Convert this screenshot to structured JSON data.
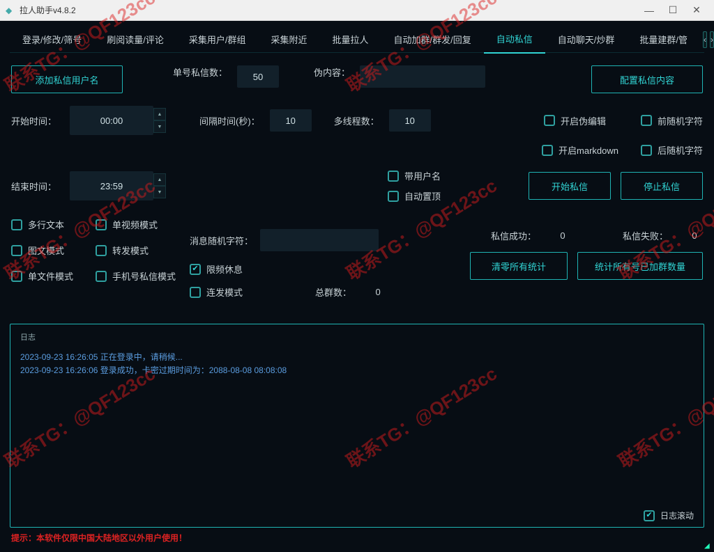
{
  "titlebar": {
    "title": "拉人助手v4.8.2",
    "min": "—",
    "max": "☐",
    "close": "✕"
  },
  "tabs": {
    "items": [
      {
        "label": "登录/修改/筛号"
      },
      {
        "label": "刷阅读量/评论"
      },
      {
        "label": "采集用户/群组"
      },
      {
        "label": "采集附近"
      },
      {
        "label": "批量拉人"
      },
      {
        "label": "自动加群/群发/回复"
      },
      {
        "label": "自动私信",
        "active": true
      },
      {
        "label": "自动聊天/炒群"
      },
      {
        "label": "批量建群/管"
      }
    ],
    "prev": "‹",
    "next": "›"
  },
  "panel": {
    "add_user_btn": "添加私信用户名",
    "per_account_label": "单号私信数：",
    "per_account_value": "50",
    "fake_content_label": "伪内容：",
    "fake_content_value": "",
    "config_dm_btn": "配置私信内容",
    "start_time_label": "开始时间：",
    "start_time_value": "00:00",
    "interval_label": "间隔时间(秒)：",
    "interval_value": "10",
    "threads_label": "多线程数：",
    "threads_value": "10",
    "end_time_label": "结束时间：",
    "end_time_value": "23:59",
    "ck_with_user": "带用户名",
    "ck_auto_top": "自动置顶",
    "ck_fake_edit": "开启伪编辑",
    "ck_prefix": "前随机字符",
    "ck_markdown": "开启markdown",
    "ck_suffix": "后随机字符",
    "start_dm_btn": "开始私信",
    "stop_dm_btn": "停止私信",
    "ck_multiline": "多行文本",
    "ck_single_video": "单视频模式",
    "ck_image_text": "图文模式",
    "ck_forward": "转发模式",
    "ck_single_file": "单文件模式",
    "ck_phone_dm": "手机号私信模式",
    "ck_rate_limit": "限频休息",
    "ck_burst": "连发模式",
    "random_char_label": "消息随机字符：",
    "random_char_value": "",
    "success_label": "私信成功：",
    "success_value": "0",
    "fail_label": "私信失败：",
    "fail_value": "0",
    "total_groups_label": "总群数：",
    "total_groups_value": "0",
    "reset_stats_btn": "清零所有统计",
    "count_groups_btn": "统计所有号已加群数量"
  },
  "log": {
    "label": "日志",
    "lines": [
      "2023-09-23 16:26:05 正在登录中，请稍候...",
      "2023-09-23 16:26:06 登录成功，卡密过期时间为：2088-08-08 08:08:08"
    ],
    "scroll_label": "日志滚动",
    "scroll_checked": true
  },
  "disclaimer": "提示：本软件仅限中国大陆地区以外用户使用！",
  "watermark": "联系TG：@QF123cc"
}
